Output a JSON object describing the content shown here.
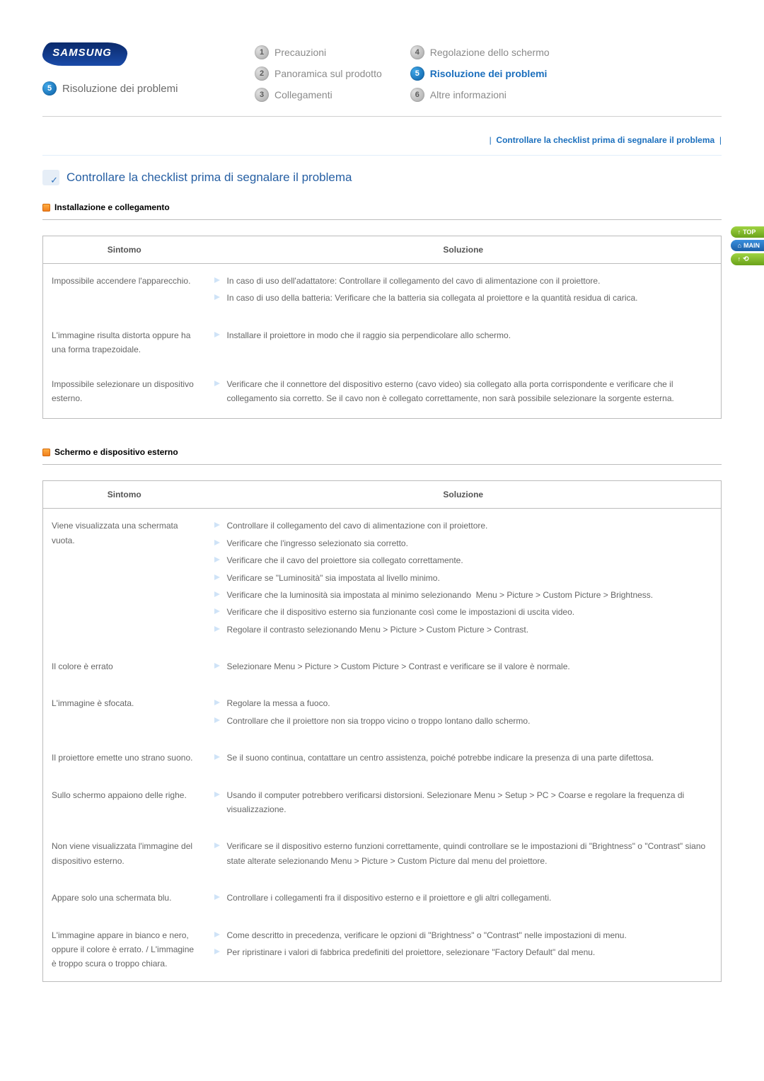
{
  "brand": "SAMSUNG",
  "page_title_num": "5",
  "page_title": "Risoluzione dei problemi",
  "nav": {
    "col1": [
      {
        "n": "1",
        "label": "Precauzioni"
      },
      {
        "n": "2",
        "label": "Panoramica sul prodotto"
      },
      {
        "n": "3",
        "label": "Collegamenti"
      }
    ],
    "col2": [
      {
        "n": "4",
        "label": "Regolazione dello schermo"
      },
      {
        "n": "5",
        "label": "Risoluzione dei problemi"
      },
      {
        "n": "6",
        "label": "Altre informazioni"
      }
    ]
  },
  "crumb_link": "Controllare la checklist prima di segnalare il problema",
  "section_heading": "Controllare la checklist prima di segnalare il problema",
  "table_headers": {
    "symptom": "Sintomo",
    "solution": "Soluzione"
  },
  "sections": [
    {
      "title": "Installazione e collegamento",
      "rows": [
        {
          "symptom": "Impossibile accendere l'apparecchio.",
          "solutions": [
            "In caso di uso dell'adattatore: Controllare il collegamento del cavo di alimentazione con il proiettore.",
            "In caso di uso della batteria: Verificare che la batteria sia collegata al proiettore e la quantità residua di carica."
          ]
        },
        {
          "symptom": "L'immagine risulta distorta oppure ha una forma trapezoidale.",
          "solutions": [
            "Installare il proiettore in modo che il raggio sia perpendicolare allo schermo."
          ]
        },
        {
          "symptom": "Impossibile selezionare un dispositivo esterno.",
          "solutions": [
            "Verificare che il connettore del dispositivo esterno (cavo video) sia collegato alla porta corrispondente e verificare che il collegamento sia corretto. Se il cavo non è collegato correttamente, non sarà possibile selezionare la sorgente esterna."
          ]
        }
      ]
    },
    {
      "title": "Schermo e dispositivo esterno",
      "rows": [
        {
          "symptom": "Viene visualizzata una schermata vuota.",
          "solutions": [
            "Controllare il collegamento del cavo di alimentazione con il proiettore.",
            "Verificare che l'ingresso selezionato sia corretto.",
            "Verificare che il cavo del proiettore sia collegato correttamente.",
            "Verificare se \"Luminosità\" sia impostata al livello minimo.",
            "Verificare che la luminosità sia impostata al minimo selezionando  Menu > Picture > Custom Picture > Brightness.",
            "Verificare che il dispositivo esterno sia funzionante così come le impostazioni di uscita video.",
            "Regolare il contrasto selezionando Menu > Picture > Custom Picture > Contrast."
          ]
        },
        {
          "symptom": "Il colore è errato",
          "solutions": [
            "Selezionare Menu > Picture > Custom Picture > Contrast e verificare se il   valore è normale."
          ]
        },
        {
          "symptom": "L'immagine è sfocata.",
          "solutions": [
            "Regolare la messa a fuoco.",
            "Controllare che il proiettore non sia troppo vicino o troppo lontano dallo schermo."
          ]
        },
        {
          "symptom": "Il proiettore emette uno strano suono.",
          "solutions": [
            "Se il suono continua, contattare un centro assistenza, poiché potrebbe indicare la presenza di una parte difettosa."
          ]
        },
        {
          "symptom": "Sullo schermo appaiono delle righe.",
          "solutions": [
            "Usando il computer potrebbero verificarsi distorsioni. Selezionare Menu > Setup > PC > Coarse e regolare la frequenza di visualizzazione."
          ]
        },
        {
          "symptom": "Non viene visualizzata l'immagine del dispositivo esterno.",
          "solutions": [
            "Verificare se il dispositivo esterno funzioni correttamente, quindi controllare se le impostazioni di \"Brightness\" o \"Contrast\" siano state alterate selezionando Menu > Picture > Custom Picture dal menu del proiettore."
          ]
        },
        {
          "symptom": "Appare solo una schermata blu.",
          "solutions": [
            "Controllare i collegamenti fra il dispositivo esterno e il proiettore e gli altri collegamenti."
          ]
        },
        {
          "symptom": "L'immagine appare in bianco e nero, oppure il colore è errato. / L'immagine è troppo scura o troppo chiara.",
          "solutions": [
            "Come descritto in precedenza, verificare le opzioni di \"Brightness\" o \"Contrast\" nelle impostazioni di menu.",
            "Per ripristinare i valori di fabbrica predefiniti del proiettore, selezionare \"Factory Default\" dal menu."
          ]
        }
      ]
    }
  ],
  "side": {
    "top": "TOP",
    "main": "MAIN",
    "ext": ""
  }
}
